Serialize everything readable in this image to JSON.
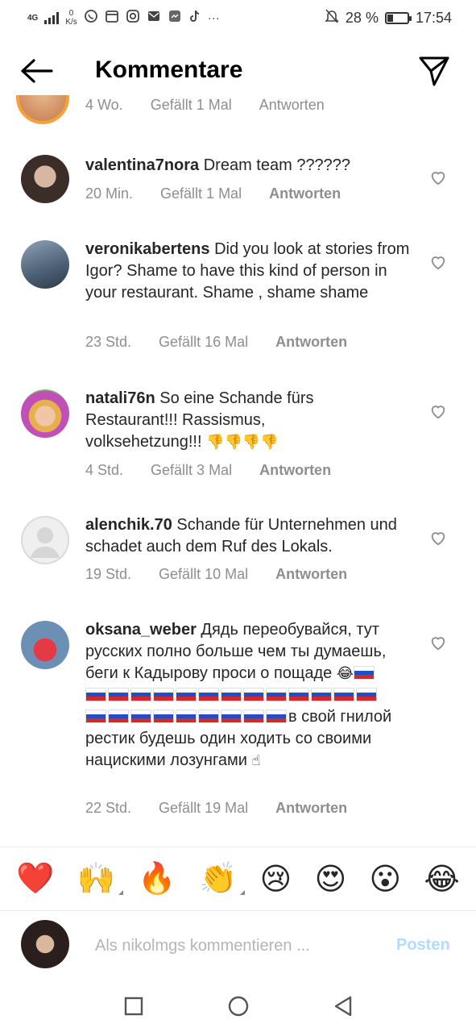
{
  "status_bar": {
    "network": "4G",
    "speed_value": "0",
    "speed_unit": "K/s",
    "battery_text": "28 %",
    "battery_level": 0.28,
    "time": "17:54",
    "more_dots": "···"
  },
  "header": {
    "title": "Kommentare"
  },
  "partial_row": {
    "time": "4 Wo.",
    "likes": "Gefällt 1 Mal",
    "reply": "Antworten"
  },
  "comments": [
    {
      "username": "valentina7nora",
      "text": " Dream team ??????",
      "time": "20 Min.",
      "likes": "Gefällt 1 Mal",
      "reply": "Antworten"
    },
    {
      "username": "veronikabertens",
      "text": " Did you look at stories from Igor?  Shame to have this kind of person in your restaurant. Shame , shame shame",
      "time": "23 Std.",
      "likes": "Gefällt 16 Mal",
      "reply": "Antworten"
    },
    {
      "username": "natali76n",
      "text": " So eine Schande fürs Restaurant!!! Rassismus, volksehetzung!!! ",
      "emoji": "👎👎👎👎",
      "time": "4 Std.",
      "likes": "Gefällt 3 Mal",
      "reply": "Antworten"
    },
    {
      "username": "alenchik.70",
      "text": " Schande für Unternehmen und schadet auch dem Ruf des Lokals.",
      "time": "19 Std.",
      "likes": "Gefällt 10 Mal",
      "reply": "Antworten"
    },
    {
      "username": "oksana_weber",
      "text_part1": " Дядь переобувайся, тут русских полно больше чем ты думаешь, беги к Кадырову проси о пощаде ",
      "emoji_laugh": "😂",
      "text_part2": "в свой гнилой рестик будешь один ходить со своими нацискими лозунгами ",
      "emoji_point": "☝",
      "time": "22 Std.",
      "likes": "Gefällt 19 Mal",
      "reply": "Antworten"
    }
  ],
  "reactions": [
    "❤️",
    "🙌",
    "🔥",
    "👏",
    "😢",
    "😍",
    "😮",
    "😂"
  ],
  "composer": {
    "placeholder": "Als nikolmgs kommentieren ...",
    "post_label": "Posten"
  }
}
